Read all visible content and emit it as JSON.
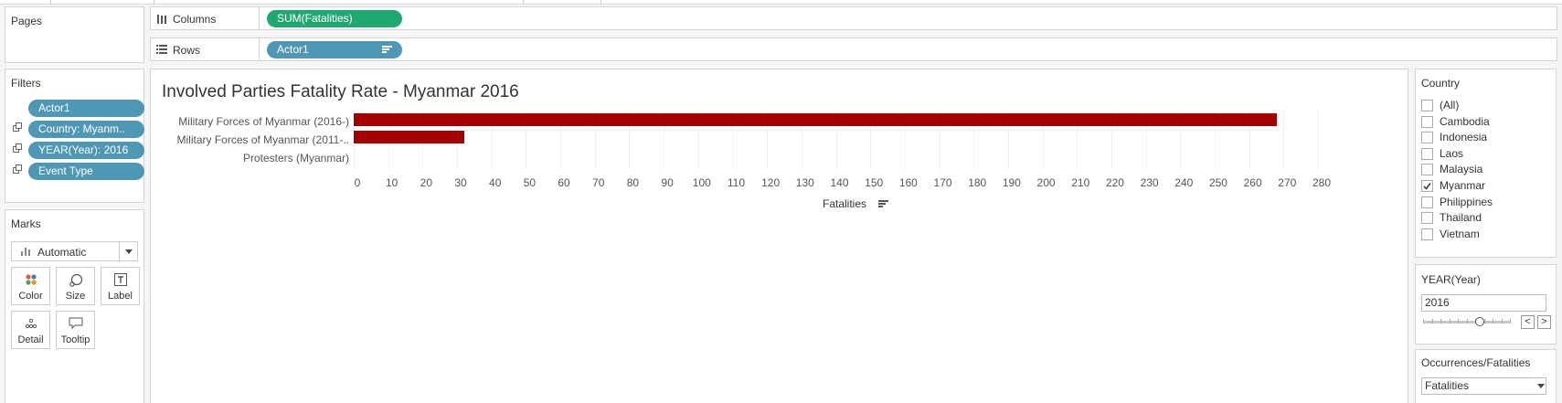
{
  "shelves": {
    "columns": {
      "label": "Columns",
      "pill": "SUM(Fatalities)"
    },
    "rows": {
      "label": "Rows",
      "pill": "Actor1"
    }
  },
  "pages": {
    "title": "Pages"
  },
  "filters": {
    "title": "Filters",
    "items": [
      "Actor1",
      "Country: Myanm..",
      "YEAR(Year): 2016",
      "Event Type"
    ]
  },
  "marks": {
    "title": "Marks",
    "type": "Automatic",
    "buttons": [
      "Color",
      "Size",
      "Label",
      "Detail",
      "Tooltip"
    ]
  },
  "viz": {
    "title": "Involved Parties Fatality Rate - Myanmar 2016"
  },
  "chart_data": {
    "type": "bar",
    "orientation": "horizontal",
    "title": "Involved Parties Fatality Rate - Myanmar 2016",
    "categories": [
      "Military Forces of Myanmar (2016-)",
      "Military Forces of Myanmar (2011-..",
      "Protesters (Myanmar)"
    ],
    "values": [
      268,
      32,
      0
    ],
    "xlabel": "Fatalities",
    "ylabel": "",
    "xlim": [
      0,
      280
    ],
    "xticks": [
      0,
      10,
      20,
      30,
      40,
      50,
      60,
      70,
      80,
      90,
      100,
      110,
      120,
      130,
      140,
      150,
      160,
      170,
      180,
      190,
      200,
      210,
      220,
      230,
      240,
      250,
      260,
      270,
      280
    ],
    "grid": true,
    "color": "#a50000"
  },
  "country_filter": {
    "title": "Country",
    "options": [
      {
        "label": "(All)",
        "checked": false
      },
      {
        "label": "Cambodia",
        "checked": false
      },
      {
        "label": "Indonesia",
        "checked": false
      },
      {
        "label": "Laos",
        "checked": false
      },
      {
        "label": "Malaysia",
        "checked": false
      },
      {
        "label": "Myanmar",
        "checked": true
      },
      {
        "label": "Philippines",
        "checked": false
      },
      {
        "label": "Thailand",
        "checked": false
      },
      {
        "label": "Vietnam",
        "checked": false
      }
    ]
  },
  "year_filter": {
    "title": "YEAR(Year)",
    "value": "2016",
    "prev": "<",
    "next": ">"
  },
  "measure_param": {
    "title": "Occurrences/Fatalities",
    "value": "Fatalities"
  },
  "colors": {
    "columns_pill": "#1fa971",
    "rows_pill": "#4f98b5",
    "bar": "#a50000"
  }
}
